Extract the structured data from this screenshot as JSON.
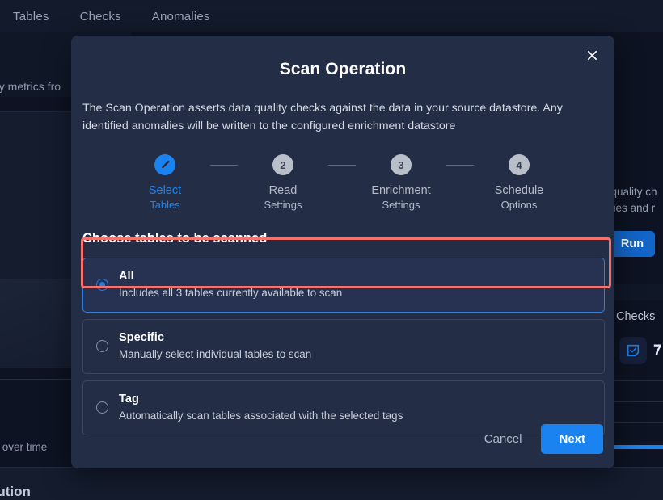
{
  "background": {
    "nav_tabs": [
      {
        "label": "Tables"
      },
      {
        "label": "Checks"
      },
      {
        "label": "Anomalies"
      }
    ],
    "text_metrics": "key metrics fro",
    "text_overtime": "ves over time",
    "text_bution": "bution",
    "right_desc_line1": ": quality ch",
    "right_desc_line2": "alies and r",
    "run_label": "Run",
    "checks_label": "Checks",
    "checks_count": "7",
    "checks_icon": "checkbox-note-icon"
  },
  "modal": {
    "title": "Scan Operation",
    "description": "The Scan Operation asserts data quality checks against the data in your source datastore. Any identified anomalies will be written to the configured enrichment datastore",
    "close_icon": "close-icon",
    "steps": [
      {
        "bubble": "✎",
        "icon": "pencil-icon",
        "line1": "Select",
        "line2": "Tables",
        "state": "active"
      },
      {
        "bubble": "2",
        "icon": "step-2-icon",
        "line1": "Read",
        "line2": "Settings",
        "state": "inactive"
      },
      {
        "bubble": "3",
        "icon": "step-3-icon",
        "line1": "Enrichment",
        "line2": "Settings",
        "state": "inactive"
      },
      {
        "bubble": "4",
        "icon": "step-4-icon",
        "line1": "Schedule",
        "line2": "Options",
        "state": "inactive"
      }
    ],
    "choose_label": "Choose tables to be scanned",
    "options": [
      {
        "id": "all",
        "title": "All",
        "subtitle": "Includes all 3 tables currently available to scan",
        "selected": true
      },
      {
        "id": "specific",
        "title": "Specific",
        "subtitle": "Manually select individual tables to scan",
        "selected": false
      },
      {
        "id": "tag",
        "title": "Tag",
        "subtitle": "Automatically scan tables associated with the selected tags",
        "selected": false
      }
    ],
    "cancel_label": "Cancel",
    "next_label": "Next"
  },
  "colors": {
    "accent_blue": "#1b83f0",
    "modal_bg": "#242d46",
    "page_bg": "#0d1322",
    "annotation_red": "#f4736e",
    "selected_option_bg": "#273252"
  }
}
